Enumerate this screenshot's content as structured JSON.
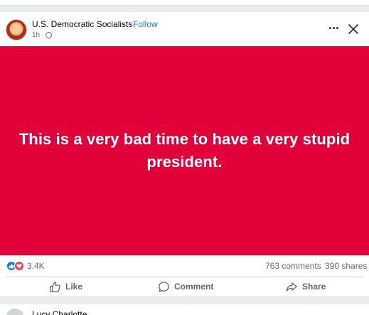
{
  "post": {
    "page_name": "U.S. Democratic Socialists",
    "separator": "·",
    "follow_label": "Follow",
    "time": "1h ·",
    "banner_text": "This is a very bad time to have a very stupid president.",
    "banner_color": "#e2003b",
    "reaction_count": "3.4K",
    "comments": "763 comments",
    "shares": "390 shares",
    "actions": {
      "like": "Like",
      "comment": "Comment",
      "share": "Share"
    }
  },
  "next_post": {
    "page_name": "Lucy Charlotte"
  },
  "icons": {
    "globe": "globe-icon",
    "more": "more-icon",
    "close": "close-icon",
    "like": "thumbs-up-icon",
    "comment": "comment-icon",
    "share": "share-icon"
  }
}
